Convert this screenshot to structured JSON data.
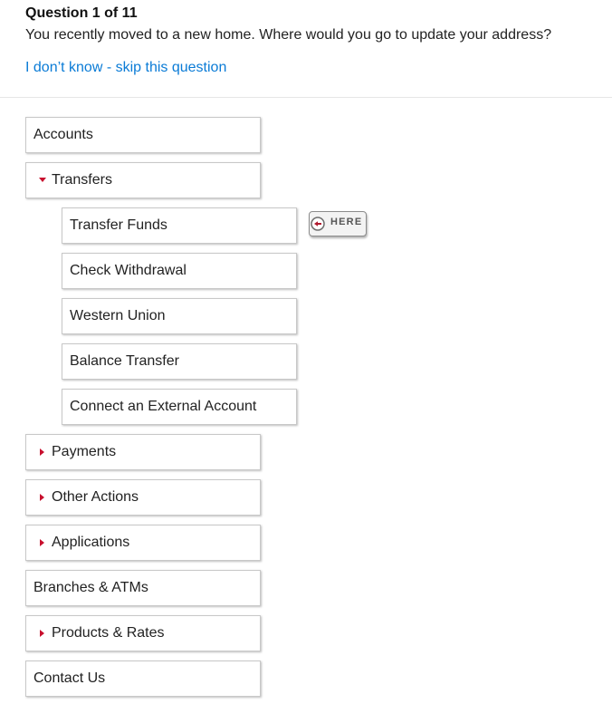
{
  "question": {
    "number_text": "Question 1 of 11",
    "text": "You recently moved to a new home. Where would you go to update your address?",
    "skip_label": "I don’t know - skip this question"
  },
  "nav": {
    "accounts": "Accounts",
    "transfers": {
      "label": "Transfers",
      "children": [
        "Transfer Funds",
        "Check Withdrawal",
        "Western Union",
        "Balance Transfer",
        "Connect an External Account"
      ]
    },
    "payments": "Payments",
    "other_actions": "Other Actions",
    "applications": "Applications",
    "branches_atms": "Branches & ATMs",
    "products_rates": "Products & Rates",
    "contact_us": "Contact Us"
  },
  "marker": {
    "label": "HERE",
    "icon": "arrow-left-circle-icon"
  },
  "colors": {
    "link": "#0a7bd6",
    "caret": "#c8102e",
    "marker_icon": "#b0192e"
  }
}
